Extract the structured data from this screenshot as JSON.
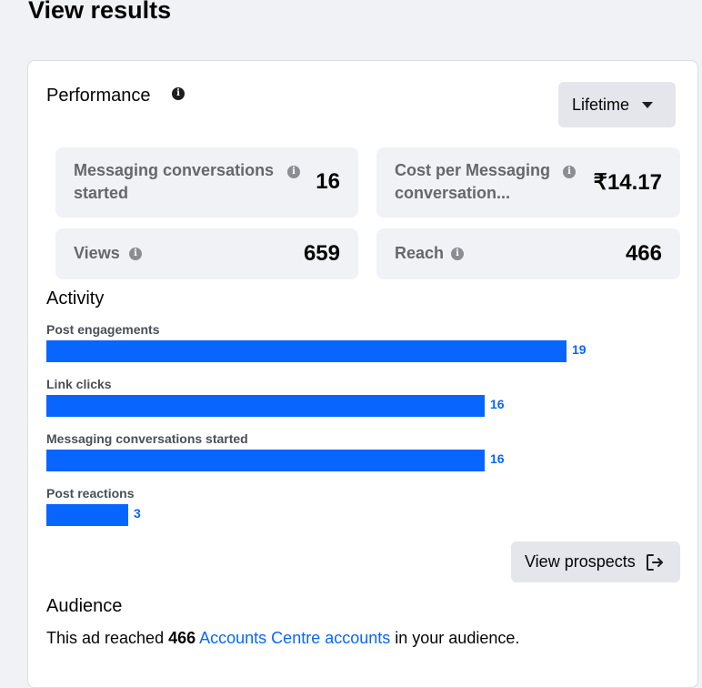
{
  "page": {
    "title": "View results"
  },
  "performance": {
    "title": "Performance",
    "period_selector": "Lifetime",
    "metrics": [
      {
        "label": "Messaging conversations started",
        "value": "16"
      },
      {
        "label": "Cost per Messaging conversation...",
        "value": "₹14.17"
      },
      {
        "label": "Views",
        "value": "659"
      },
      {
        "label": "Reach",
        "value": "466"
      }
    ]
  },
  "activity": {
    "title": "Activity",
    "items": [
      {
        "label": "Post engagements",
        "value": 19
      },
      {
        "label": "Link clicks",
        "value": 16
      },
      {
        "label": "Messaging conversations started",
        "value": 16
      },
      {
        "label": "Post reactions",
        "value": 3
      }
    ],
    "max_value": 19,
    "bar_color": "#0866ff",
    "view_prospects_label": "View prospects"
  },
  "audience": {
    "title": "Audience",
    "text_before": "This ad reached ",
    "reach_count": "466",
    "link_text": "Accounts Centre accounts",
    "text_after": " in your audience."
  },
  "icons": [
    "info-icon",
    "caret-down-icon",
    "external-link-icon"
  ]
}
